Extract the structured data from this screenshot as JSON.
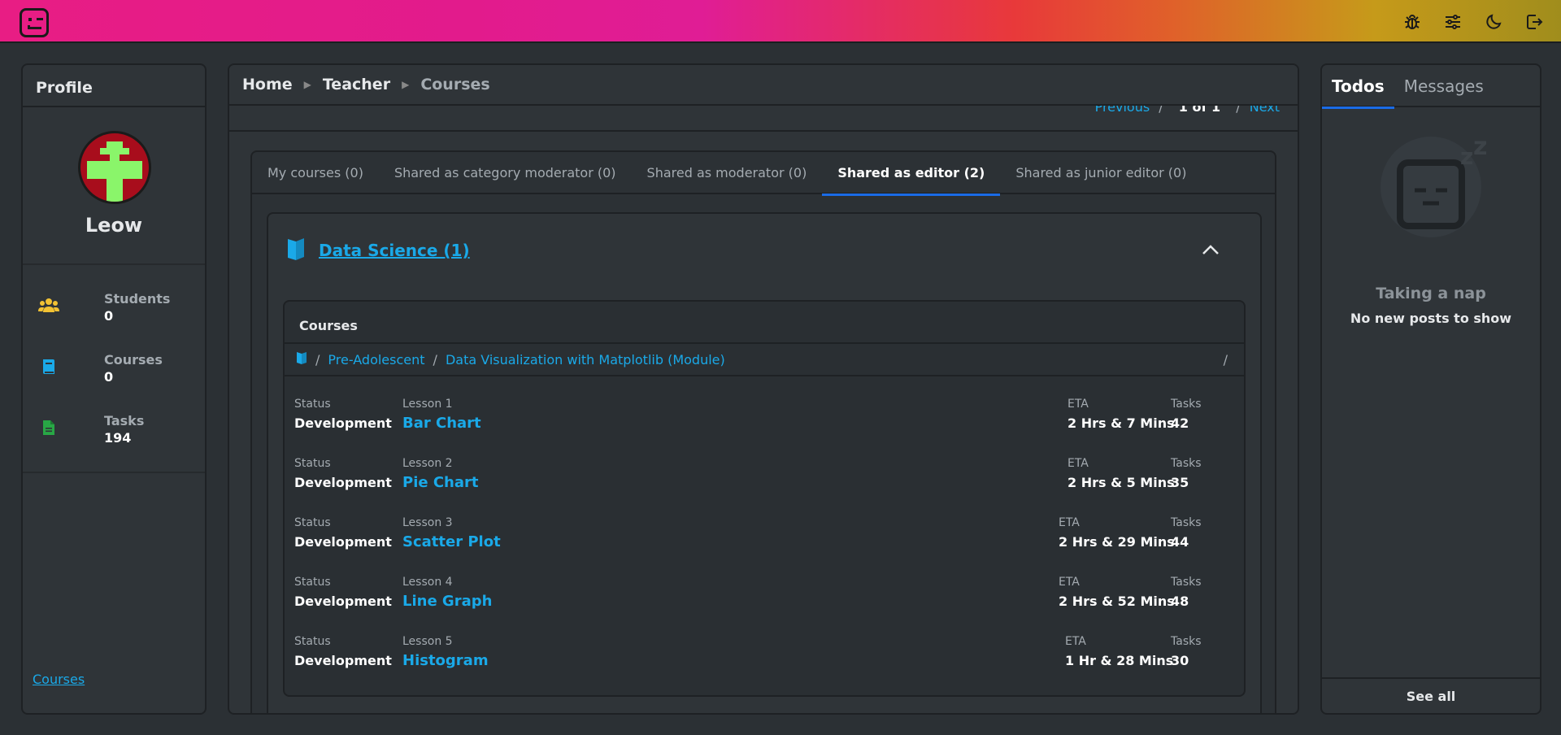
{
  "topbar": {
    "icons": [
      "bug-icon",
      "settings-sliders-icon",
      "moon-icon",
      "logout-icon"
    ]
  },
  "profile": {
    "header": "Profile",
    "name": "Leow",
    "stats": [
      {
        "label": "Students",
        "value": "0",
        "icon": "users-icon",
        "color": "#f2c233"
      },
      {
        "label": "Courses",
        "value": "0",
        "icon": "book-icon",
        "color": "#1aa9e8"
      },
      {
        "label": "Tasks",
        "value": "194",
        "icon": "document-icon",
        "color": "#28a745"
      }
    ],
    "footer_link": "Courses"
  },
  "breadcrumb": {
    "items": [
      "Home",
      "Teacher",
      "Courses"
    ]
  },
  "pager": {
    "prev": "Previous",
    "current": "1 of 1",
    "next": "Next"
  },
  "tabs": [
    {
      "label": "My courses (0)",
      "active": false
    },
    {
      "label": "Shared as category moderator (0)",
      "active": false
    },
    {
      "label": "Shared as moderator (0)",
      "active": false
    },
    {
      "label": "Shared as editor (2)",
      "active": true
    },
    {
      "label": "Shared as junior editor (0)",
      "active": false
    }
  ],
  "category": {
    "title": "Data Science (1)",
    "courses_header": "Courses",
    "path": [
      "Pre-Adolescent",
      "Data Visualization with Matplotlib (Module)"
    ],
    "path_end": "/",
    "lessons": [
      {
        "status_label": "Status",
        "status": "Development",
        "lesson_label": "Lesson 1",
        "name": "Bar Chart",
        "eta_label": "ETA",
        "eta": "2 Hrs & 7 Mins",
        "tasks_label": "Tasks",
        "tasks": "42"
      },
      {
        "status_label": "Status",
        "status": "Development",
        "lesson_label": "Lesson 2",
        "name": "Pie Chart",
        "eta_label": "ETA",
        "eta": "2 Hrs & 5 Mins",
        "tasks_label": "Tasks",
        "tasks": "35"
      },
      {
        "status_label": "Status",
        "status": "Development",
        "lesson_label": "Lesson 3",
        "name": "Scatter Plot",
        "eta_label": "ETA",
        "eta": "2 Hrs & 29 Mins",
        "tasks_label": "Tasks",
        "tasks": "44"
      },
      {
        "status_label": "Status",
        "status": "Development",
        "lesson_label": "Lesson 4",
        "name": "Line Graph",
        "eta_label": "ETA",
        "eta": "2 Hrs & 52 Mins",
        "tasks_label": "Tasks",
        "tasks": "48"
      },
      {
        "status_label": "Status",
        "status": "Development",
        "lesson_label": "Lesson 5",
        "name": "Histogram",
        "eta_label": "ETA",
        "eta": "1 Hr & 28 Mins",
        "tasks_label": "Tasks",
        "tasks": "30"
      }
    ]
  },
  "todos": {
    "tabs": [
      {
        "label": "Todos",
        "active": true
      },
      {
        "label": "Messages",
        "active": false
      }
    ],
    "empty_title": "Taking a nap",
    "empty_sub": "No new posts to show",
    "see_all": "See all"
  }
}
